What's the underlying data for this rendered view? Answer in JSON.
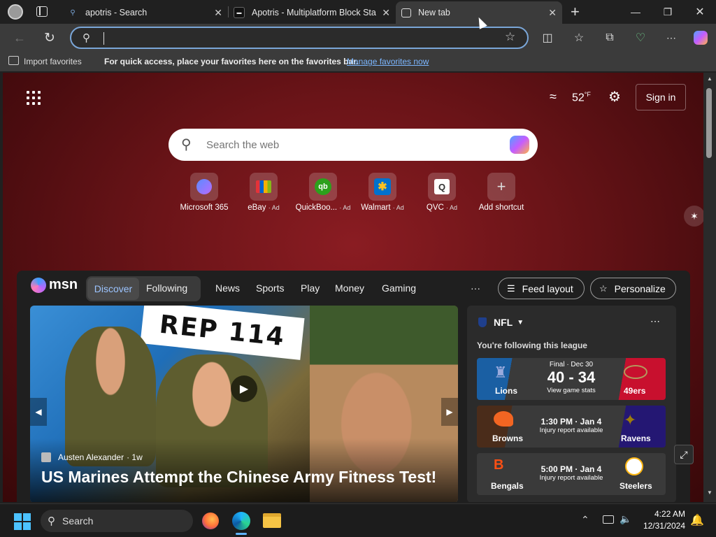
{
  "tabs": [
    {
      "title": "apotris - Search",
      "active": false
    },
    {
      "title": "Apotris - Multiplatform Block Sta",
      "active": false
    },
    {
      "title": "New tab",
      "active": true
    }
  ],
  "favbar": {
    "import_label": "Import favorites",
    "message": "For quick access, place your favorites here on the favorites bar.",
    "manage_link": "Manage favorites now"
  },
  "weather": {
    "temp": "52",
    "unit": "°F"
  },
  "signin_label": "Sign in",
  "search": {
    "placeholder": "Search the web"
  },
  "shortcuts": [
    {
      "label": "Microsoft 365",
      "ad": ""
    },
    {
      "label": "eBay",
      "ad": "· Ad"
    },
    {
      "label": "QuickBoo...",
      "ad": "· Ad"
    },
    {
      "label": "Walmart",
      "ad": "· Ad"
    },
    {
      "label": "QVC",
      "ad": "· Ad"
    },
    {
      "label": "Add shortcut",
      "ad": ""
    }
  ],
  "msn": {
    "logo": "msn",
    "toggle": [
      "Discover",
      "Following"
    ],
    "nav": [
      "News",
      "Sports",
      "Play",
      "Money",
      "Gaming"
    ],
    "more": "···",
    "feed_layout": "Feed layout",
    "personalize": "Personalize"
  },
  "hero": {
    "thumb_text": "REP 114",
    "author": "Austen Alexander",
    "age": "· 1w",
    "title": "US Marines Attempt the Chinese Army Fitness Test!"
  },
  "nfl": {
    "league": "NFL",
    "following": "You're following this league",
    "games": [
      {
        "home": "Lions",
        "away": "49ers",
        "status": "Final · Dec 30",
        "score": "40 - 34",
        "sub": "View game stats"
      },
      {
        "home": "Browns",
        "away": "Ravens",
        "status": "1:30 PM · Jan 4",
        "score": "",
        "sub": "Injury report available"
      },
      {
        "home": "Bengals",
        "away": "Steelers",
        "status": "5:00 PM · Jan 4",
        "score": "",
        "sub": "Injury report available"
      }
    ]
  },
  "taskbar": {
    "search": "Search",
    "time": "4:22 AM",
    "date": "12/31/2024"
  },
  "colors": {
    "accent": "#7aa6d8",
    "link": "#7cb7ff",
    "background": "#6b1418"
  }
}
